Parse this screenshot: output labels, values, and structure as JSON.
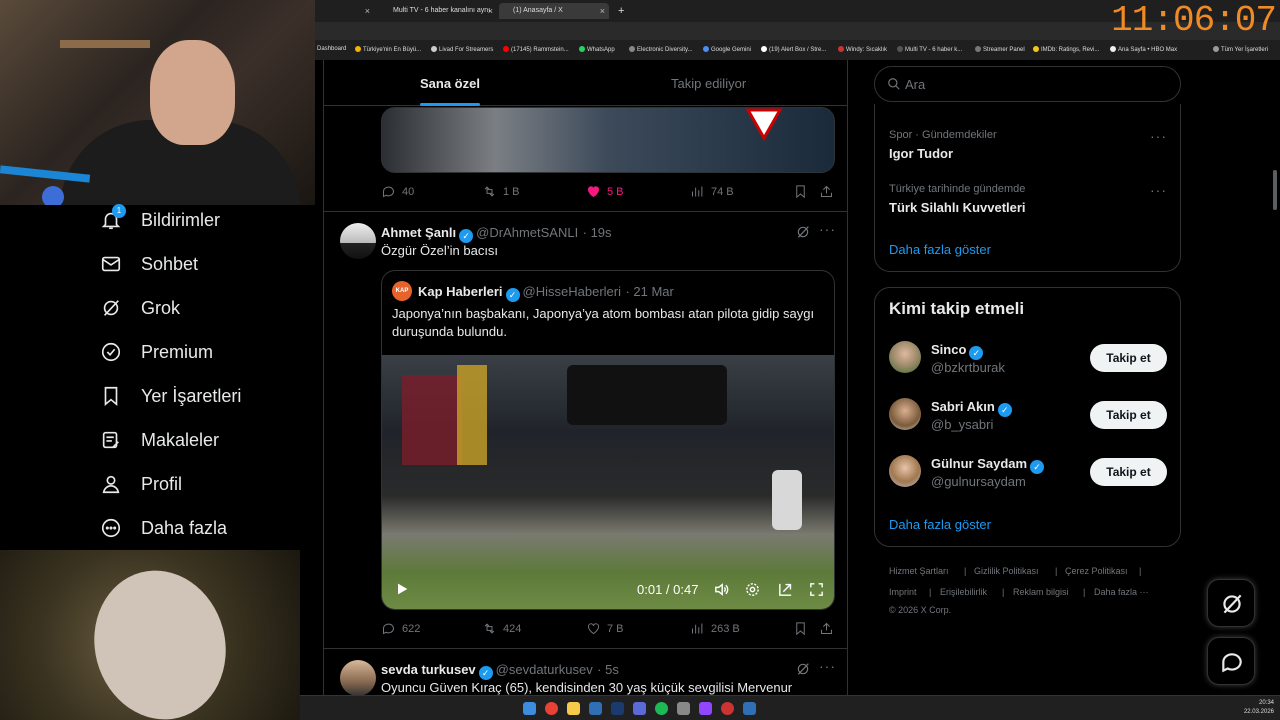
{
  "browser": {
    "tabs": [
      {
        "label": ""
      },
      {
        "label": "Multi TV - 6 haber kanalını aynı"
      },
      {
        "label": "(1) Anasayfa / X"
      }
    ],
    "new_tab": "+",
    "bookmarks": [
      "Dashboard",
      "Türkiye'nin En Büyü...",
      "Livad For Streamers",
      "(17145) Rammstein...",
      "WhatsApp",
      "Electronic Diversity...",
      "Google Gemini",
      "(19) Alert Box / Stre...",
      "Windy: Sıcaklık",
      "Multi TV - 6 haber k...",
      "Streamer Panel",
      "IMDb: Ratings, Revi...",
      "Ana Sayfa • HBO Max",
      "Tüm Yer İşaretleri"
    ]
  },
  "clock": "11:06:07",
  "sidebar": {
    "notif_count": "1",
    "items": [
      {
        "label": "Bildirimler"
      },
      {
        "label": "Sohbet"
      },
      {
        "label": "Grok"
      },
      {
        "label": "Premium"
      },
      {
        "label": "Yer İşaretleri"
      },
      {
        "label": "Makaleler"
      },
      {
        "label": "Profil"
      },
      {
        "label": "Daha fazla"
      }
    ]
  },
  "feed": {
    "tabs": [
      "Sana özel",
      "Takip ediliyor"
    ],
    "tweet0": {
      "replies": "40",
      "retweets": "1 B",
      "likes": "5 B",
      "views": "74 B"
    },
    "tweet1": {
      "name": "Ahmet Şanlı",
      "handle": "@DrAhmetSANLI",
      "time": "· 19s",
      "text": "Özgür Özel’in bacısı",
      "quote": {
        "avatar_text": "KAP",
        "name": "Kap Haberleri",
        "handle": "@HisseHaberleri",
        "time": "· 21 Mar",
        "text": "Japonya’nın başbakanı, Japonya’ya atom bombası atan pilota gidip saygı duruşunda bulundu.",
        "video_time": "0:01 / 0:47"
      },
      "replies": "622",
      "retweets": "424",
      "likes": "7 B",
      "views": "263 B"
    },
    "tweet2": {
      "name": "sevda turkusev",
      "handle": "@sevdaturkusev",
      "time": "· 5s",
      "text": "Oyuncu Güven Kıraç (65), kendisinden 30 yaş küçük sevgilisi Mervenur"
    }
  },
  "right": {
    "search_placeholder": "Ara",
    "trends": [
      {
        "category": "Spor · Gündemdekiler",
        "name": "Igor Tudor"
      },
      {
        "category": "Türkiye tarihinde gündemde",
        "name": "Türk Silahlı Kuvvetleri"
      }
    ],
    "trends_more": "Daha fazla göster",
    "who_to_follow": {
      "title": "Kimi takip etmeli",
      "users": [
        {
          "name": "Sinco",
          "handle": "@bzkrtburak",
          "button": "Takip et"
        },
        {
          "name": "Sabri Akın",
          "handle": "@b_ysabri",
          "button": "Takip et"
        },
        {
          "name": "Gülnur Saydam",
          "handle": "@gulnursaydam",
          "button": "Takip et"
        }
      ],
      "more": "Daha fazla göster"
    },
    "footer": {
      "links1": [
        "Hizmet Şartları",
        "Gizlilik Politikası",
        "Çerez Politikası"
      ],
      "links2": [
        "Imprint",
        "Erişilebilirlik",
        "Reklam bilgisi",
        "Daha fazla ···"
      ],
      "copyright": "© 2026 X Corp."
    }
  },
  "taskbar": {
    "time": "20:34",
    "date": "22.03.2026"
  },
  "colors": {
    "accent": "#1d9bf0",
    "like": "#f91880",
    "clock": "#f08a24"
  }
}
